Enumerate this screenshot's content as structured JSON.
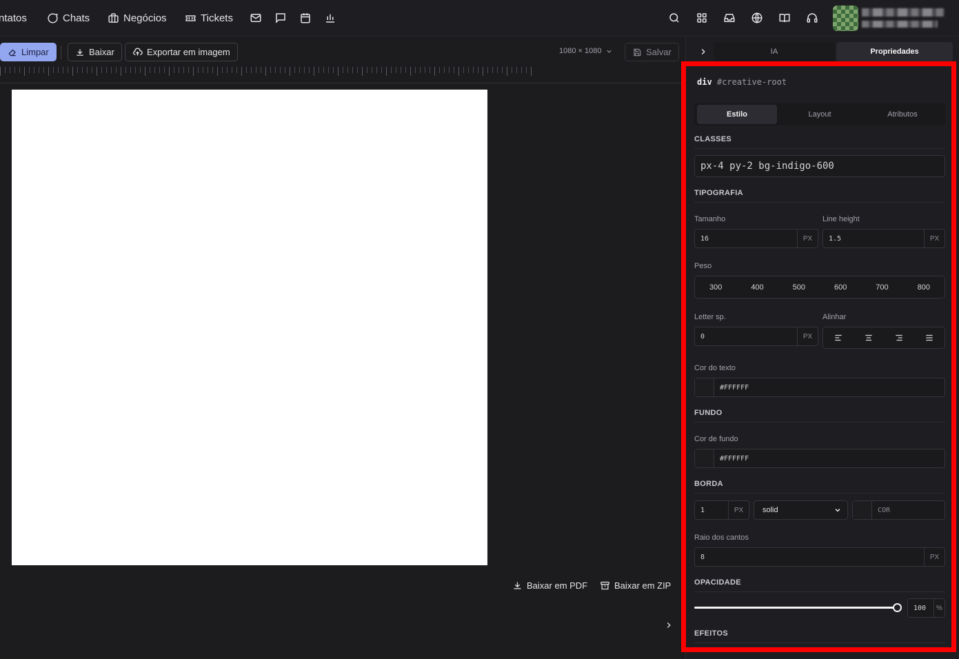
{
  "topnav": {
    "items": [
      {
        "label": "ntatos",
        "icon": "none"
      },
      {
        "label": "Chats",
        "icon": "chat-bubble-icon"
      },
      {
        "label": "Negócios",
        "icon": "briefcase-icon"
      },
      {
        "label": "Tickets",
        "icon": "ticket-icon"
      }
    ],
    "icons": [
      "mail-icon",
      "message-square-icon",
      "calendar-icon",
      "bar-chart-icon"
    ],
    "right_icons": [
      "search-icon",
      "apps-grid-icon",
      "inbox-icon",
      "globe-icon",
      "book-icon",
      "headset-icon"
    ]
  },
  "toolbar": {
    "clear_label": "Limpar",
    "download_label": "Baixar",
    "export_label": "Exportar em imagem",
    "size_label": "1080 × 1080",
    "save_label": "Salvar"
  },
  "footer": {
    "pdf_label": "Baixar em PDF",
    "zip_label": "Baixar em ZIP"
  },
  "panel": {
    "tabs": [
      "IA",
      "Propriedades"
    ],
    "active_tab": "Propriedades",
    "element_tag": "div",
    "element_id": "#creative-root",
    "subtabs": [
      "Estilo",
      "Layout",
      "Atributos"
    ],
    "active_subtab": "Estilo",
    "classes": {
      "heading": "CLASSES",
      "value": "px-4 py-2 bg-indigo-600"
    },
    "typography": {
      "heading": "TIPOGRAFIA",
      "size_label": "Tamanho",
      "size_value": "16",
      "size_unit": "PX",
      "line_height_label": "Line height",
      "line_height_value": "1.5",
      "line_height_unit": "PX",
      "weight_label": "Peso",
      "weights": [
        "300",
        "400",
        "500",
        "600",
        "700",
        "800"
      ],
      "letter_spacing_label": "Letter sp.",
      "letter_spacing_value": "0",
      "letter_spacing_unit": "PX",
      "align_label": "Alinhar",
      "text_color_label": "Cor do texto",
      "text_color_value": "#FFFFFF"
    },
    "background": {
      "heading": "FUNDO",
      "color_label": "Cor de fundo",
      "color_value": "#FFFFFF"
    },
    "border": {
      "heading": "BORDA",
      "width_value": "1",
      "width_unit": "PX",
      "style_value": "solid",
      "color_placeholder": "COR",
      "radius_label": "Raio dos cantos",
      "radius_value": "8",
      "radius_unit": "PX"
    },
    "opacity": {
      "heading": "OPACIDADE",
      "value": "100",
      "unit": "%",
      "level": 1.0
    },
    "effects": {
      "heading": "EFEITOS"
    }
  },
  "colors": {
    "primary_button": "#93a6f0",
    "highlight_box": "#ff0000",
    "canvas": "#ffffff"
  }
}
